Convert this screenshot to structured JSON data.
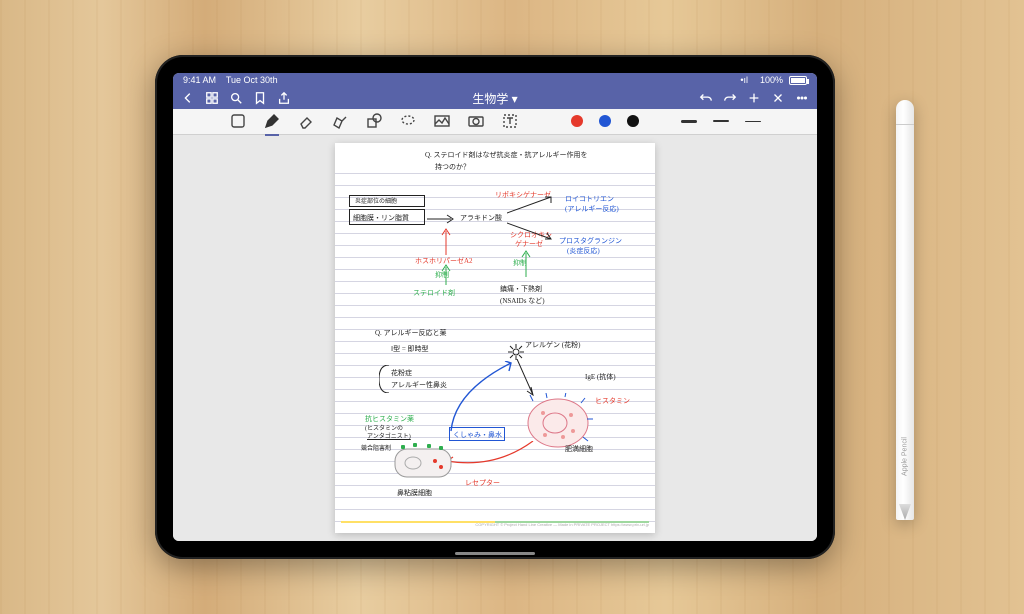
{
  "status": {
    "time": "9:41 AM",
    "date": "Tue Oct 30th",
    "wifi": "100%"
  },
  "nav": {
    "title": "生物学 ▾"
  },
  "toolbar": {
    "tools": [
      "default",
      "pen",
      "eraser",
      "highlighter",
      "shapes",
      "lasso",
      "image",
      "camera",
      "text"
    ],
    "colors": [
      "red",
      "blue",
      "black"
    ]
  },
  "notes": {
    "q1_line1": "Q. ステロイド剤はなぜ抗炎症・抗アレルギー作用を",
    "q1_line2": "持つのか？",
    "box_label_small": "炎症部位の細胞",
    "box_label": "細胞膜・リン脂質",
    "arachidonic": "アラキドン酸",
    "lipoxy": "リポキシゲナーゼ",
    "leukotriene_1": "ロイコトリエン",
    "leukotriene_2": "(アレルギー反応)",
    "cyclo_1": "シクロオキシ",
    "cyclo_2": "ゲナーゼ",
    "prosta_1": "プロスタグランジン",
    "prosta_2": "(炎症反応)",
    "phospholipase": "ホスホリパーゼA2",
    "inhibit1": "抑制",
    "inhibit2": "抑制",
    "steroid": "ステロイド剤",
    "nsaid_1": "鎮痛・下熱剤",
    "nsaid_2": "(NSAIDs など)",
    "q2": "Q. アレルギー反応と薬",
    "type1": "Ⅰ型 = 即時型",
    "hayfever": "花粉症",
    "rhinitis": "アレルギー性鼻炎",
    "allergen": "アレルゲン (花粉)",
    "ige": "IgE (抗体)",
    "histamine": "ヒスタミン",
    "mastcell": "肥満細胞",
    "antihist1": "抗ヒスタミン薬",
    "antihist2": "(ヒスタミンの",
    "antihist3": "アンタゴニスト)",
    "sneeze": "くしゃみ・鼻水",
    "nasal": "鼻粘膜細胞",
    "receptor": "レセプター",
    "competitive": "競合阻害剤"
  },
  "pencil_label": "Apple Pencil",
  "footer": "COPYRIGHT © Project Hand Line Creative — Made in PRIVATE PROJECT   https://www.priv-url.jp"
}
